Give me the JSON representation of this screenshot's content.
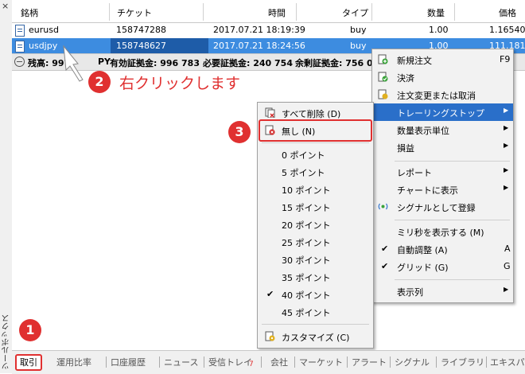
{
  "sidebar": {
    "close_label": "×",
    "vertical_label": "ツールボックス"
  },
  "columns": {
    "symbol": "銘柄",
    "ticket": "チケット",
    "time": "時間",
    "type": "タイプ",
    "volume": "数量",
    "price": "価格"
  },
  "rows": [
    {
      "symbol": "eurusd",
      "ticket": "158747288",
      "time": "2017.07.21 18:19:39",
      "type": "buy",
      "volume": "1.00",
      "price": "1.16540"
    },
    {
      "symbol": "usdjpy",
      "ticket": "158748627",
      "time": "2017.07.21 18:24:56",
      "type": "buy",
      "volume": "1.00",
      "price": "111.181"
    }
  ],
  "balance": {
    "text1": "残高: 997",
    "text2": "PY",
    "effective": "有効証拠金: 996 783",
    "required": "必要証拠金: 240 754",
    "free": "余剰証拠金: 756 0"
  },
  "context_menu": {
    "items": [
      {
        "label": "新規注文",
        "shortcut": "F9",
        "icon": "new-order-icon"
      },
      {
        "label": "決済",
        "icon": "close-position-icon"
      },
      {
        "label": "注文変更または取消",
        "icon": "modify-order-icon"
      },
      {
        "label": "トレーリングストップ",
        "submenu": true,
        "highlighted": true
      },
      {
        "label": "数量表示単位",
        "submenu": true
      },
      {
        "label": "損益",
        "submenu": true
      },
      {
        "label": "レポート",
        "submenu": true
      },
      {
        "label": "チャートに表示",
        "submenu": true
      },
      {
        "label": "シグナルとして登録",
        "icon": "signal-icon"
      },
      {
        "label": "ミリ秒を表示する (M)"
      },
      {
        "label": "自動調整 (A)",
        "shortcut": "A",
        "checked": true
      },
      {
        "label": "グリッド (G)",
        "shortcut": "G",
        "checked": true
      },
      {
        "label": "表示列",
        "submenu": true
      }
    ]
  },
  "trailing_menu": {
    "delete_all": "すべて削除 (D)",
    "none": "無し (N)",
    "points": [
      "0 ポイント",
      "5 ポイント",
      "10 ポイント",
      "15 ポイント",
      "20 ポイント",
      "25 ポイント",
      "30 ポイント",
      "35 ポイント",
      "40 ポイント",
      "45 ポイント"
    ],
    "checked_point": "40 ポイント",
    "customize": "カスタマイズ (C)"
  },
  "tabs": [
    "取引",
    "運用比率",
    "口座履歴",
    "ニュース",
    "受信トレイ",
    "会社",
    "マーケット",
    "アラート",
    "シグナル",
    "ライブラリ",
    "エキスパー"
  ],
  "inbox_badge": "7",
  "callouts": {
    "step1": "1",
    "step2": "2",
    "step2_text": "右クリックします",
    "step3": "3"
  },
  "colors": {
    "accent_red": "#e03030",
    "selection_blue": "#3d8ce0",
    "menu_highlight": "#2a6fc9"
  }
}
